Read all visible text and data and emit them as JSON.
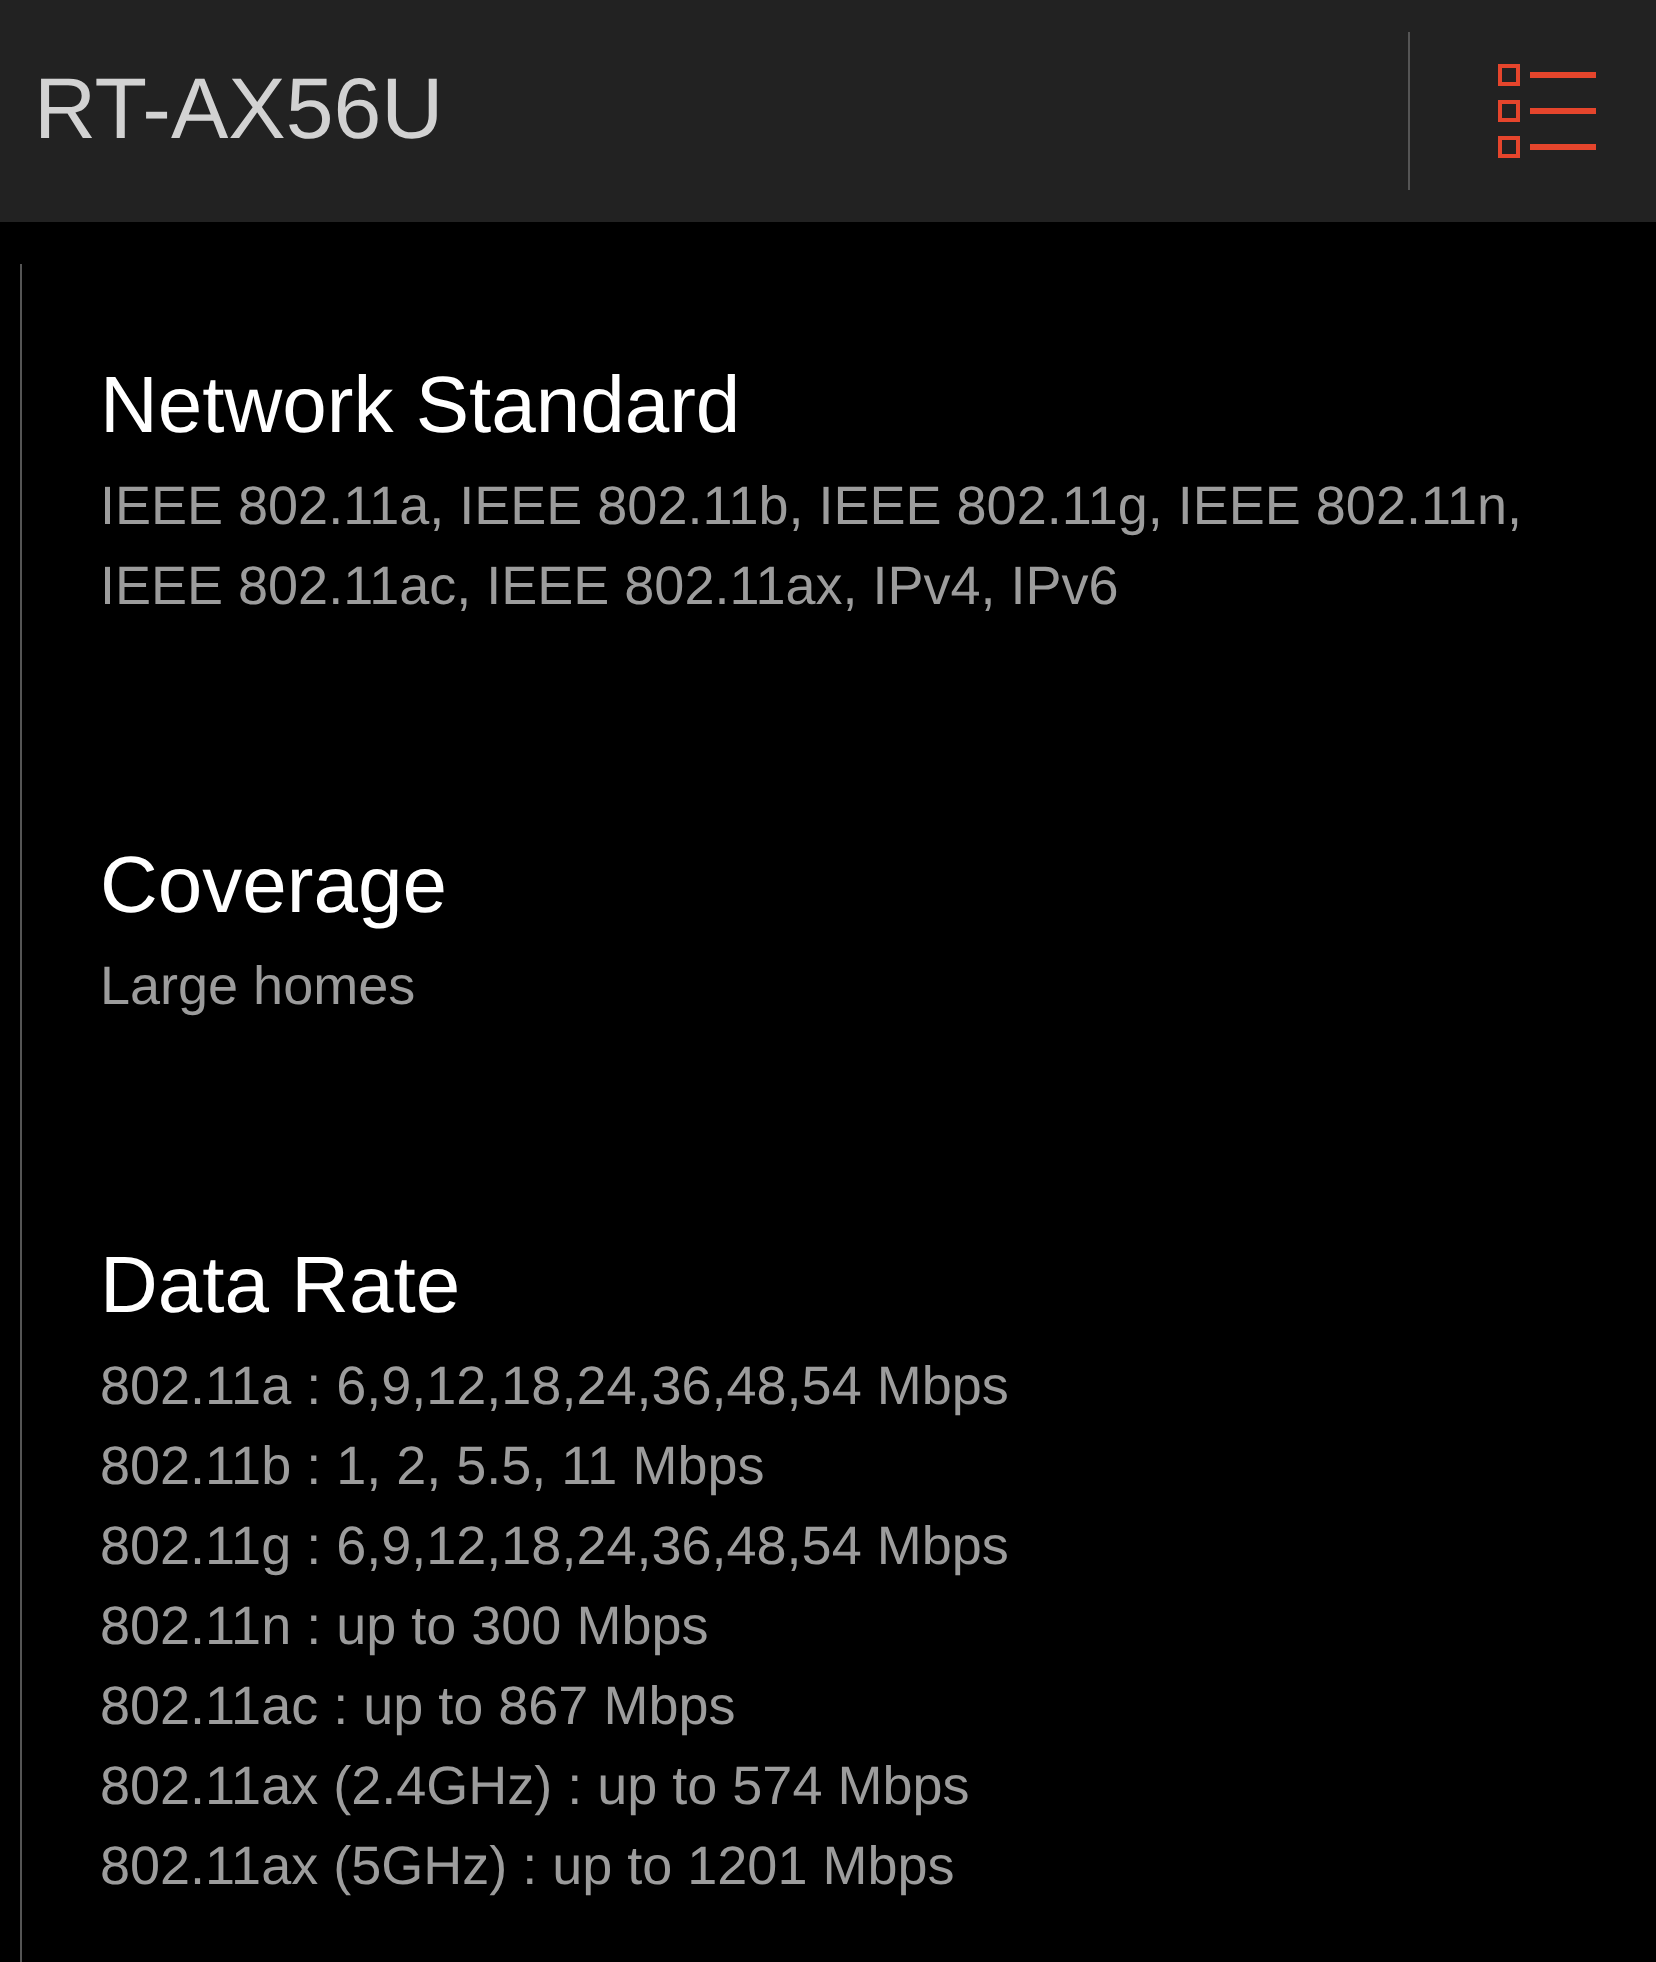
{
  "header": {
    "title": "RT-AX56U"
  },
  "sections": [
    {
      "heading": "Network Standard",
      "items": [
        "IEEE 802.11a, IEEE 802.11b, IEEE 802.11g, IEEE 802.11n, IEEE 802.11ac, IEEE 802.11ax, IPv4, IPv6"
      ]
    },
    {
      "heading": "Coverage",
      "items": [
        "Large homes"
      ]
    },
    {
      "heading": "Data Rate",
      "items": [
        "802.11a : 6,9,12,18,24,36,48,54 Mbps",
        "802.11b : 1, 2, 5.5, 11 Mbps",
        "802.11g : 6,9,12,18,24,36,48,54 Mbps",
        "802.11n : up to 300 Mbps",
        "802.11ac : up to 867 Mbps",
        "802.11ax (2.4GHz) : up to 574 Mbps",
        "802.11ax (5GHz) : up to 1201 Mbps"
      ]
    }
  ]
}
